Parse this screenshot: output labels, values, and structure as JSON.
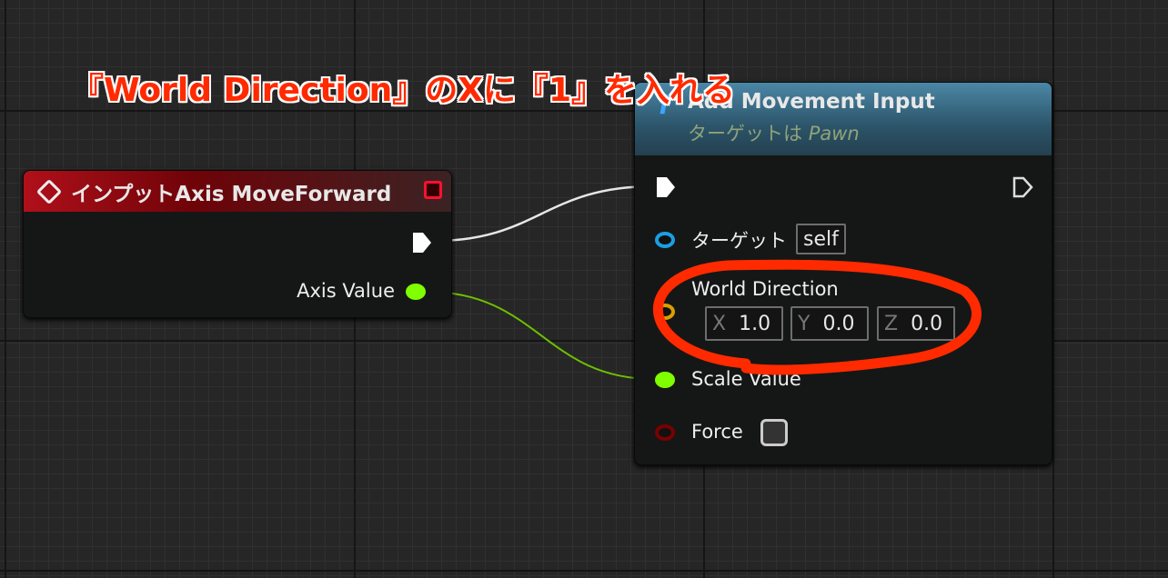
{
  "annotation": "『World Direction』のXに『1』を入れる",
  "colors": {
    "annotation": "#ff2a00",
    "event_header": "#8e0a12",
    "function_header": "#2c5469",
    "float_pin": "#7fff00",
    "object_pin": "#1aa0e0",
    "vector_pin": "#d9a000",
    "bool_pin": "#8a0000"
  },
  "input_node": {
    "title": "インプットAxis MoveForward",
    "icon": "event-diamond-icon",
    "axis_value_label": "Axis Value"
  },
  "function_node": {
    "icon": "function-f-icon",
    "title": "Add Movement Input",
    "subtitle_prefix": "ターゲットは",
    "subtitle_class": "Pawn",
    "target_label": "ターゲット",
    "target_value": "self",
    "world_direction_label": "World Direction",
    "x_label": "X",
    "x_value": "1.0",
    "y_label": "Y",
    "y_value": "0.0",
    "z_label": "Z",
    "z_value": "0.0",
    "scale_label": "Scale Value",
    "force_label": "Force",
    "force_checked": false
  }
}
